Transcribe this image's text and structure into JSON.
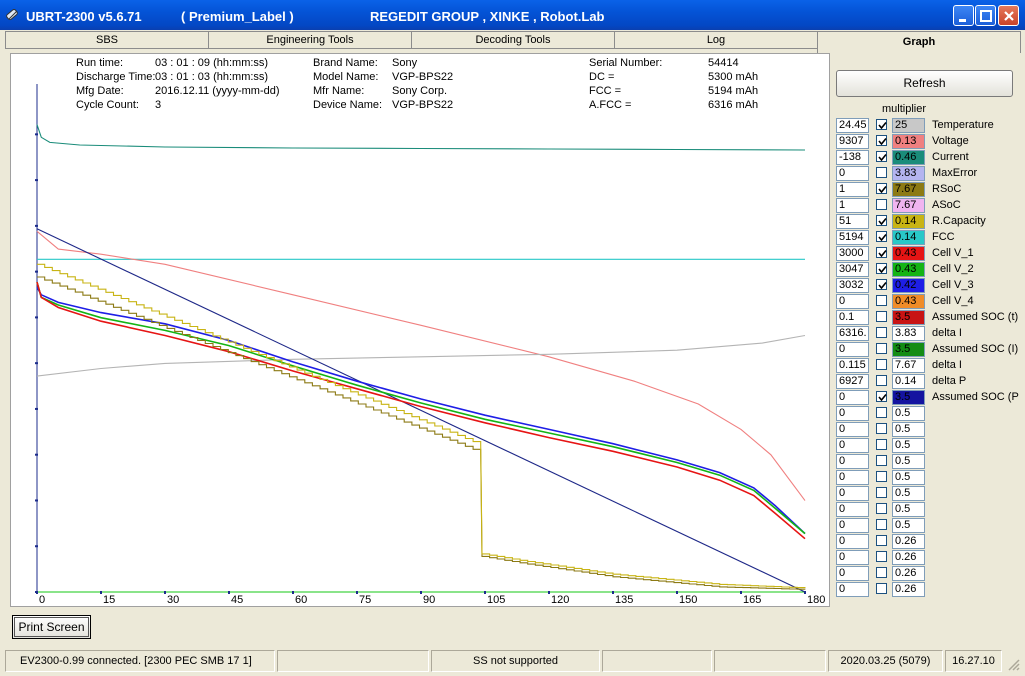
{
  "window": {
    "title": "UBRT-2300 v5.6.71",
    "label": "( Premium_Label )",
    "group": "REGEDIT GROUP , XINKE , Robot.Lab"
  },
  "tabs": [
    {
      "label": "SBS"
    },
    {
      "label": "Engineering Tools"
    },
    {
      "label": "Decoding Tools"
    },
    {
      "label": "Log"
    },
    {
      "label": "Graph",
      "active": true
    }
  ],
  "info": {
    "run_time_label": "Run time:",
    "run_time": "03 : 01 : 09 (hh:mm:ss)",
    "discharge_label": "Discharge Time:",
    "discharge": "03 : 01 : 03 (hh:mm:ss)",
    "mfg_label": "Mfg Date:",
    "mfg": "2016.12.11 (yyyy-mm-dd)",
    "cycle_label": "Cycle Count:",
    "cycle": "3",
    "brand_label": "Brand Name:",
    "brand": "Sony",
    "model_label": "Model Name:",
    "model": "VGP-BPS22",
    "mfr_label": "Mfr Name:",
    "mfr": "Sony Corp.",
    "device_label": "Device Name:",
    "device": "VGP-BPS22",
    "serial_label": "Serial Number:",
    "serial": "54414",
    "dc_label": "DC =",
    "dc": "5300 mAh",
    "fcc_label": "FCC =",
    "fcc": "5194 mAh",
    "afcc_label": "A.FCC =",
    "afcc": "6316 mAh"
  },
  "refresh_label": "Refresh",
  "multiplier_label": "multiplier",
  "series": [
    {
      "value": "24.45",
      "checked": true,
      "mult": "25",
      "color": "#c8c8c8",
      "name": "Temperature"
    },
    {
      "value": "9307",
      "checked": true,
      "mult": "0.13",
      "color": "#f08080",
      "name": "Voltage"
    },
    {
      "value": "-138",
      "checked": true,
      "mult": "0.46",
      "color": "#1a8c7a",
      "name": "Current"
    },
    {
      "value": "0",
      "checked": false,
      "mult": "3.83",
      "color": "#b4b4f0",
      "name": "MaxError"
    },
    {
      "value": "1",
      "checked": true,
      "mult": "7.67",
      "color": "#8c7a14",
      "name": "RSoC"
    },
    {
      "value": "1",
      "checked": false,
      "mult": "7.67",
      "color": "#f0b4f0",
      "name": "ASoC"
    },
    {
      "value": "51",
      "checked": true,
      "mult": "0.14",
      "color": "#c8b414",
      "name": "R.Capacity"
    },
    {
      "value": "5194",
      "checked": true,
      "mult": "0.14",
      "color": "#28c8c8",
      "name": "FCC"
    },
    {
      "value": "3000",
      "checked": true,
      "mult": "0.43",
      "color": "#e61414",
      "name": "Cell V_1"
    },
    {
      "value": "3047",
      "checked": true,
      "mult": "0.43",
      "color": "#14b414",
      "name": "Cell V_2"
    },
    {
      "value": "3032",
      "checked": true,
      "mult": "0.42",
      "color": "#1e1ee6",
      "name": "Cell V_3"
    },
    {
      "value": "0",
      "checked": false,
      "mult": "0.43",
      "color": "#f08c28",
      "name": "Cell V_4"
    },
    {
      "value": "0.1",
      "checked": false,
      "mult": "3.5",
      "color": "#c81414",
      "name": "Assumed SOC (t)"
    },
    {
      "value": "6316.",
      "checked": false,
      "mult": "3.83",
      "color": "#ffffff",
      "name": "delta I"
    },
    {
      "value": "0",
      "checked": false,
      "mult": "3.5",
      "color": "#148c14",
      "name": "Assumed SOC (I)"
    },
    {
      "value": "0.115",
      "checked": false,
      "mult": "7.67",
      "color": "#ffffff",
      "name": "delta I"
    },
    {
      "value": "6927",
      "checked": false,
      "mult": "0.14",
      "color": "#ffffff",
      "name": "delta P"
    },
    {
      "value": "0",
      "checked": true,
      "mult": "3.5",
      "color": "#1414a0",
      "name": "Assumed SOC (P"
    },
    {
      "value": "0",
      "checked": false,
      "mult": "0.5",
      "color": "#ffffff",
      "name": ""
    },
    {
      "value": "0",
      "checked": false,
      "mult": "0.5",
      "color": "#ffffff",
      "name": ""
    },
    {
      "value": "0",
      "checked": false,
      "mult": "0.5",
      "color": "#ffffff",
      "name": ""
    },
    {
      "value": "0",
      "checked": false,
      "mult": "0.5",
      "color": "#ffffff",
      "name": ""
    },
    {
      "value": "0",
      "checked": false,
      "mult": "0.5",
      "color": "#ffffff",
      "name": ""
    },
    {
      "value": "0",
      "checked": false,
      "mult": "0.5",
      "color": "#ffffff",
      "name": ""
    },
    {
      "value": "0",
      "checked": false,
      "mult": "0.5",
      "color": "#ffffff",
      "name": ""
    },
    {
      "value": "0",
      "checked": false,
      "mult": "0.5",
      "color": "#ffffff",
      "name": ""
    },
    {
      "value": "0",
      "checked": false,
      "mult": "0.26",
      "color": "#ffffff",
      "name": ""
    },
    {
      "value": "0",
      "checked": false,
      "mult": "0.26",
      "color": "#ffffff",
      "name": ""
    },
    {
      "value": "0",
      "checked": false,
      "mult": "0.26",
      "color": "#ffffff",
      "name": ""
    },
    {
      "value": "0",
      "checked": false,
      "mult": "0.26",
      "color": "#ffffff",
      "name": ""
    }
  ],
  "print_label": "Print Screen",
  "status": {
    "connection": "EV2300-0.99 connected. [2300  PEC  SMB  17 1]",
    "ss": "SS not supported",
    "date": "2020.03.25  (5079)",
    "time": "16.27.10"
  },
  "chart_data": {
    "type": "line",
    "x_ticks": [
      "0",
      "15",
      "30",
      "45",
      "60",
      "75",
      "90",
      "105",
      "120",
      "135",
      "150",
      "165",
      "180"
    ],
    "xlim": [
      0,
      180
    ],
    "ylim": [
      0,
      100
    ],
    "series": [
      {
        "name": "Current",
        "color": "#1a8c7a",
        "x": [
          0,
          1,
          3,
          10,
          30,
          60,
          90,
          120,
          150,
          180
        ],
        "y": [
          92,
          89.5,
          88.5,
          88,
          87.6,
          87.4,
          87.3,
          87.2,
          87.1,
          87
        ]
      },
      {
        "name": "FCC",
        "color": "#28c8c8",
        "x": [
          0,
          180
        ],
        "y": [
          65.5,
          65.5
        ]
      },
      {
        "name": "Voltage",
        "color": "#f08080",
        "x": [
          0,
          5,
          15,
          30,
          60,
          90,
          120,
          140,
          155,
          165,
          172,
          180
        ],
        "y": [
          71,
          67.5,
          66.5,
          64.5,
          58.5,
          52.5,
          46.3,
          41.5,
          37,
          32,
          27,
          18
        ]
      },
      {
        "name": "Temperature",
        "color": "#b4b4b4",
        "x": [
          0,
          15,
          30,
          60,
          90,
          120,
          150,
          170,
          180
        ],
        "y": [
          42.5,
          44,
          45,
          45.8,
          46.3,
          46.8,
          47.6,
          49,
          50.5
        ]
      },
      {
        "name": "Assumed SOC (P",
        "color": "#1e2888",
        "x": [
          0,
          180
        ],
        "y": [
          71.5,
          0
        ]
      },
      {
        "name": "Cell V_3",
        "color": "#1e1ee6",
        "x": [
          0,
          1,
          5,
          15,
          30,
          45,
          60,
          75,
          90,
          105,
          120,
          135,
          150,
          160,
          168,
          173,
          180
        ],
        "y": [
          60,
          58.5,
          57,
          55,
          52.8,
          49.5,
          45.3,
          41.5,
          38,
          34.8,
          32,
          29.2,
          26,
          23.5,
          20.5,
          17,
          11.5
        ]
      },
      {
        "name": "Cell V_2",
        "color": "#14b414",
        "x": [
          0,
          1,
          5,
          15,
          30,
          45,
          60,
          75,
          90,
          105,
          120,
          135,
          150,
          160,
          168,
          173,
          180
        ],
        "y": [
          61,
          58,
          56.5,
          54,
          51.5,
          48.5,
          44.5,
          40.7,
          37.2,
          34,
          31.3,
          28.6,
          25.5,
          23,
          20,
          16.5,
          11.5
        ]
      },
      {
        "name": "Cell V_1",
        "color": "#e61414",
        "x": [
          0,
          1,
          5,
          15,
          30,
          45,
          60,
          75,
          90,
          105,
          120,
          135,
          150,
          160,
          168,
          173,
          180
        ],
        "y": [
          61,
          58,
          56,
          53.3,
          50.5,
          47.3,
          43.5,
          40,
          36.5,
          33.3,
          30.4,
          27.7,
          24.6,
          22,
          19,
          15.5,
          10.5
        ]
      },
      {
        "name": "RSoC",
        "color": "#8c7a14",
        "step": true,
        "x": [
          0,
          104,
          104.3,
          115,
          135,
          160,
          180
        ],
        "y": [
          62,
          27.5,
          7,
          5.5,
          3,
          1,
          0.5
        ]
      },
      {
        "name": "R.Capacity",
        "color": "#c8b414",
        "step": true,
        "x": [
          0,
          104,
          104.3,
          115,
          135,
          160,
          180
        ],
        "y": [
          64.5,
          29,
          7.5,
          6,
          3.5,
          1.5,
          0.8
        ]
      }
    ]
  }
}
